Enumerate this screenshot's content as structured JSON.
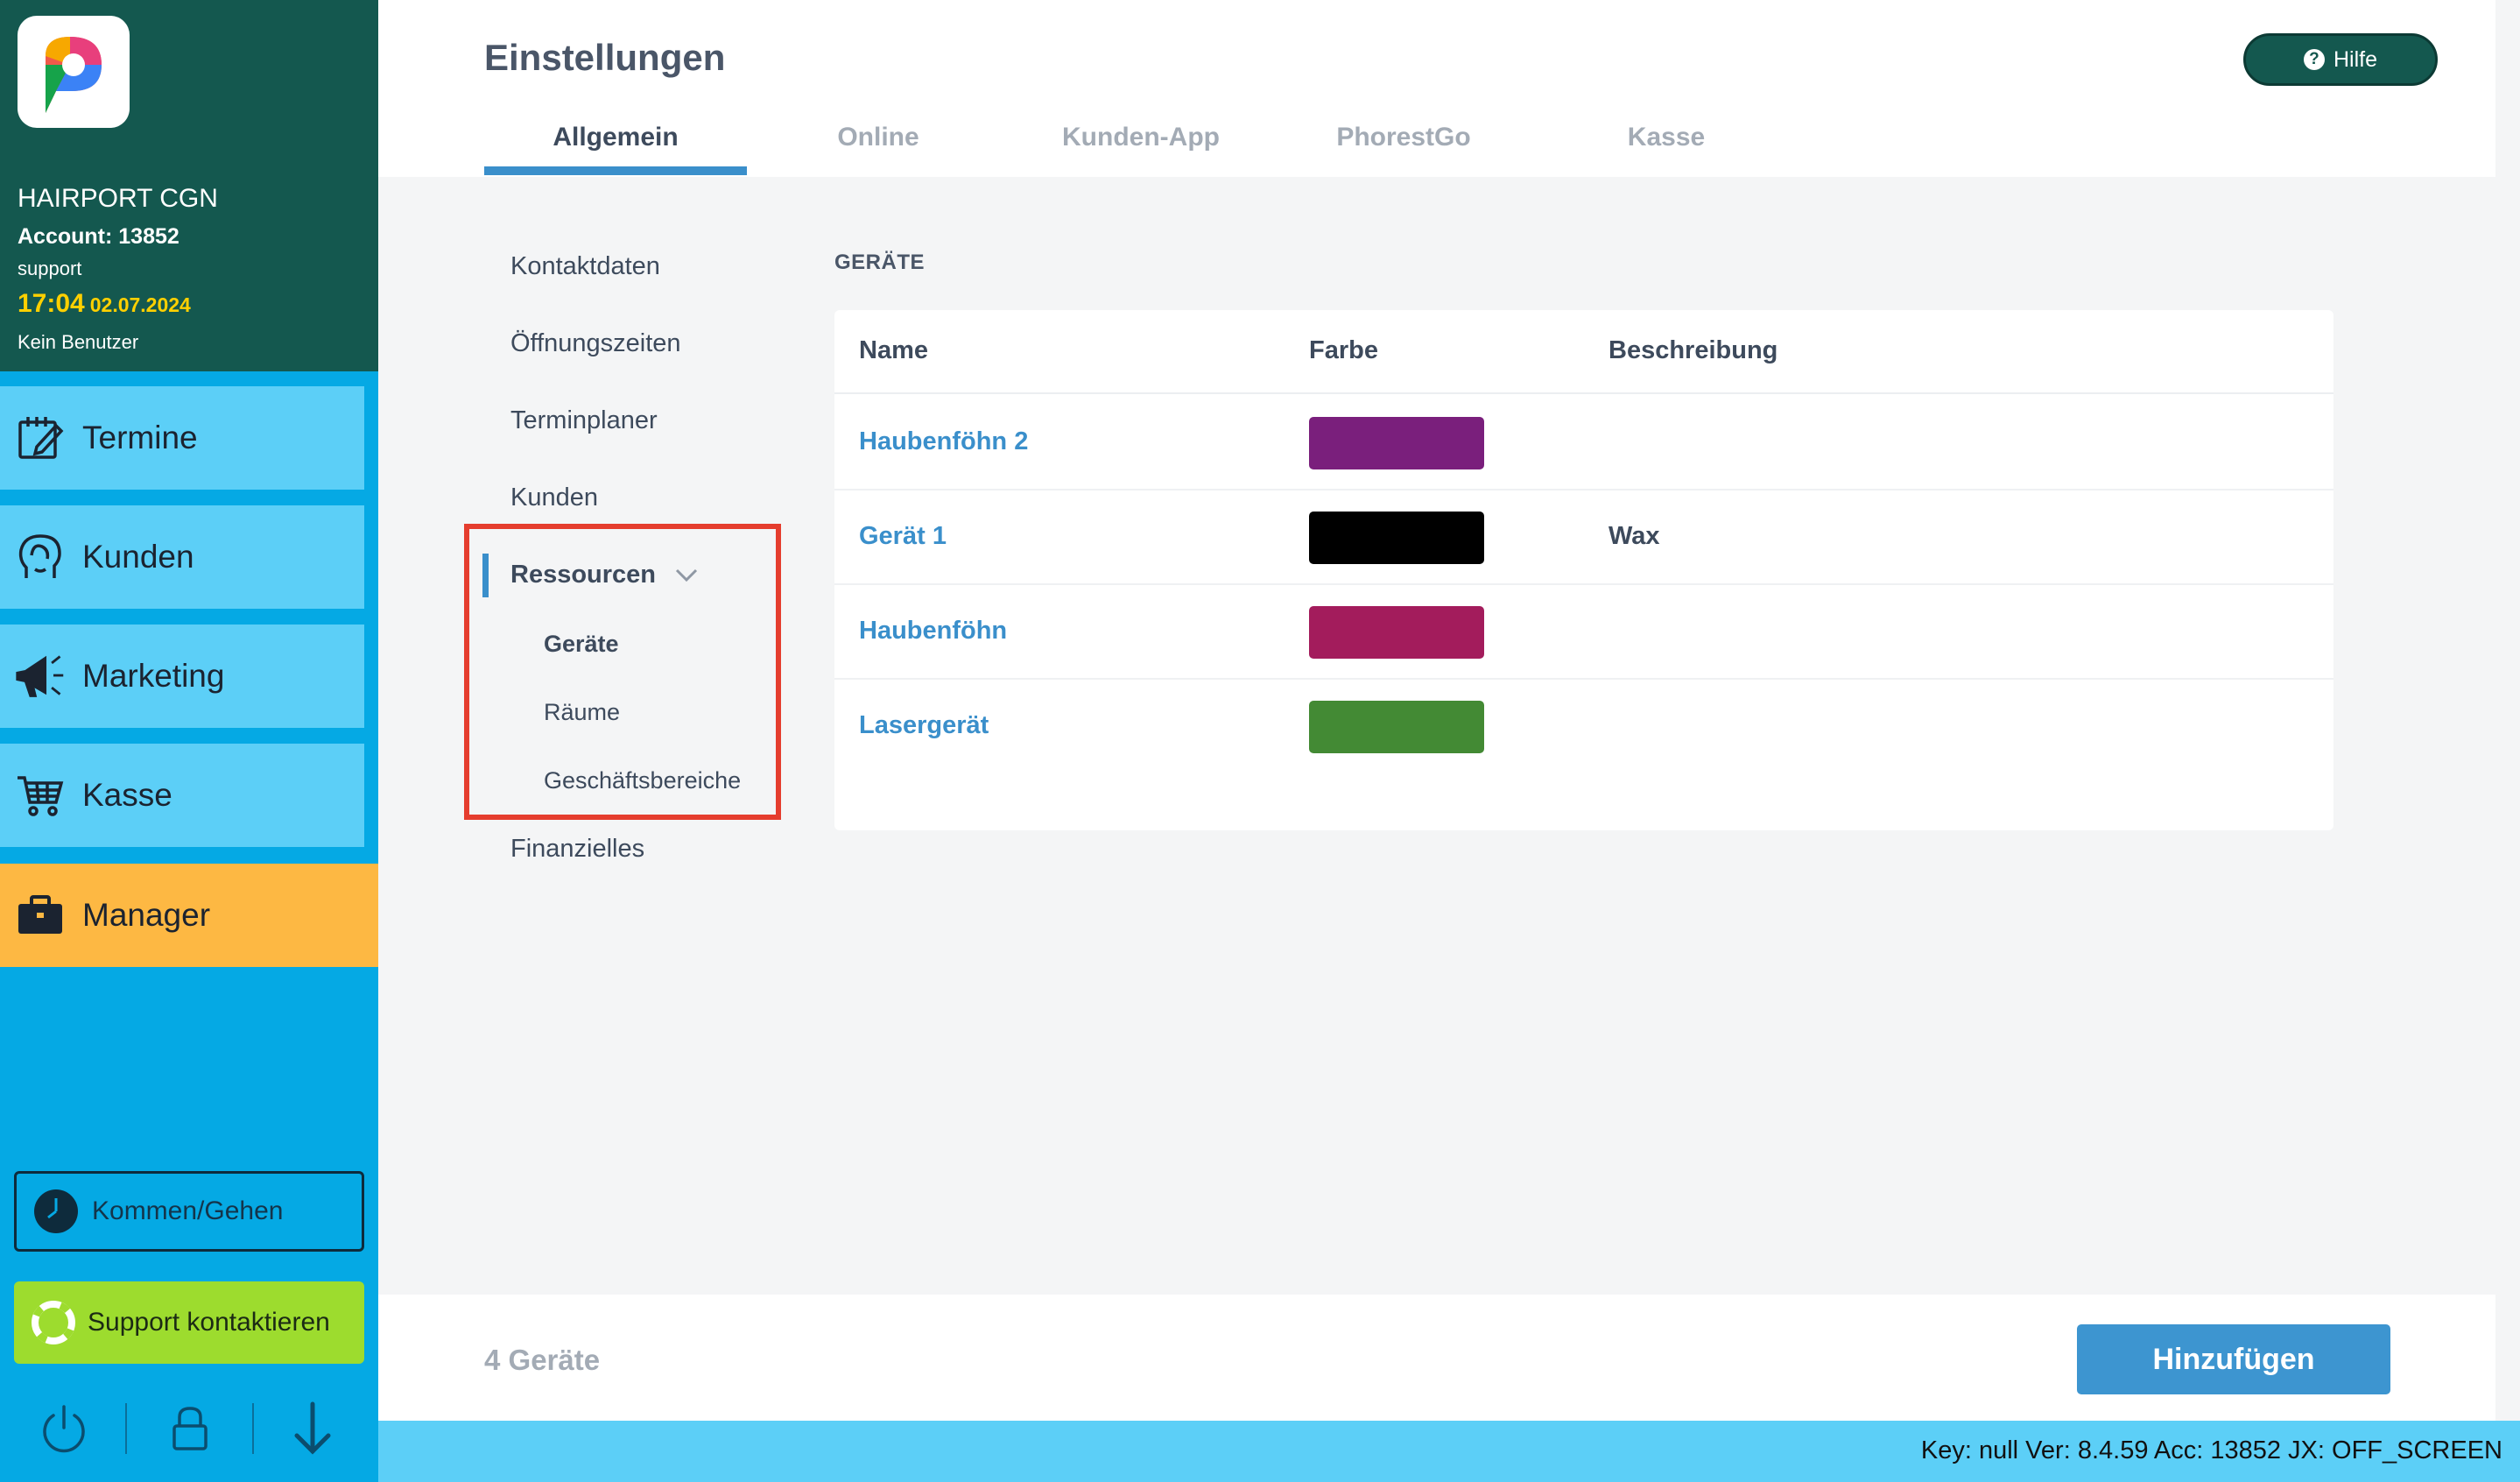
{
  "sidebar": {
    "salon_name": "HAIRPORT CGN",
    "account": "Account: 13852",
    "user": "support",
    "time": "17:04",
    "date": "02.07.2024",
    "no_user": "Kein Benutzer",
    "nav": [
      {
        "label": "Termine",
        "icon": "calendar-edit-icon"
      },
      {
        "label": "Kunden",
        "icon": "customer-head-icon"
      },
      {
        "label": "Marketing",
        "icon": "megaphone-icon"
      },
      {
        "label": "Kasse",
        "icon": "cart-icon"
      },
      {
        "label": "Manager",
        "icon": "briefcase-icon"
      }
    ],
    "kommen_gehen": "Kommen/Gehen",
    "support": "Support kontaktieren",
    "colors": {
      "header": "#14584f",
      "nav": "#5ccff7",
      "manager": "#fdb843",
      "support": "#9ddc2e"
    }
  },
  "header": {
    "title": "Einstellungen",
    "help": "Hilfe",
    "tabs": [
      {
        "label": "Allgemein",
        "active": true
      },
      {
        "label": "Online",
        "active": false
      },
      {
        "label": "Kunden-App",
        "active": false
      },
      {
        "label": "PhorestGo",
        "active": false
      },
      {
        "label": "Kasse",
        "active": false
      }
    ]
  },
  "submenu": {
    "items": [
      "Kontaktdaten",
      "Öffnungszeiten",
      "Terminplaner",
      "Kunden"
    ],
    "ressourcen": "Ressourcen",
    "ressourcen_children": [
      "Geräte",
      "Räume",
      "Geschäftsbereiche"
    ],
    "finanzielles": "Finanzielles"
  },
  "content": {
    "section_title": "GERÄTE",
    "columns": [
      "Name",
      "Farbe",
      "Beschreibung"
    ],
    "rows": [
      {
        "name": "Haubenföhn 2",
        "color": "#7a1f7c",
        "description": ""
      },
      {
        "name": "Gerät 1",
        "color": "#000000",
        "description": "Wax"
      },
      {
        "name": "Haubenföhn",
        "color": "#a31c5c",
        "description": ""
      },
      {
        "name": "Lasergerät",
        "color": "#438a34",
        "description": ""
      }
    ]
  },
  "footer": {
    "count": "4 Geräte",
    "add": "Hinzufügen"
  },
  "status_bar": "Key: null Ver: 8.4.59 Acc: 13852  JX: OFF_SCREEN"
}
